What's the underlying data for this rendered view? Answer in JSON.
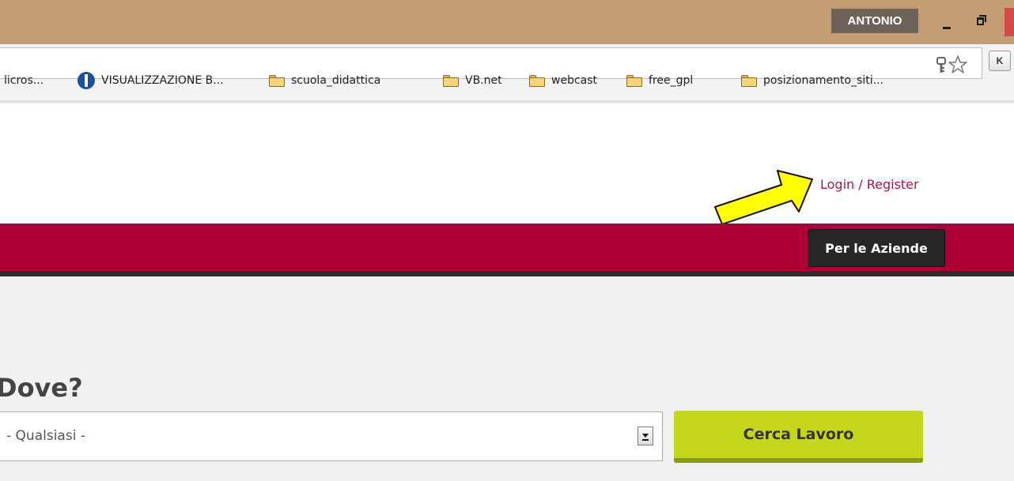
{
  "window": {
    "user_badge": "ANTONIO",
    "min_icon": "minimize-icon",
    "max_icon": "restore-icon"
  },
  "browser": {
    "address_value": "",
    "icons": [
      "key-icon",
      "star-icon",
      "extension-k-icon"
    ],
    "extension_label": "K"
  },
  "bookmarks": {
    "items": [
      {
        "label": "licros...",
        "icon": "none"
      },
      {
        "label": "VISUALIZZAZIONE B...",
        "icon": "vb-icon"
      },
      {
        "label": "scuola_didattica",
        "icon": "folder-icon"
      },
      {
        "label": "VB.net",
        "icon": "folder-icon"
      },
      {
        "label": "webcast",
        "icon": "folder-icon"
      },
      {
        "label": "free_gpl",
        "icon": "folder-icon"
      },
      {
        "label": "posizionamento_siti...",
        "icon": "folder-icon"
      }
    ]
  },
  "page": {
    "login_label": "Login / Register",
    "nav": {
      "aziende_label": "Per le Aziende"
    },
    "search": {
      "dove_label": "Dove?",
      "location_value": "- Qualsiasi -",
      "submit_label": "Cerca Lavoro"
    },
    "annotation": {
      "type": "arrow-icon",
      "color": "#ffff00"
    }
  },
  "colors": {
    "titlebar": "#c59d75",
    "brand_band": "#ad0034",
    "link": "#b0124a",
    "cta": "#c4d71c"
  }
}
